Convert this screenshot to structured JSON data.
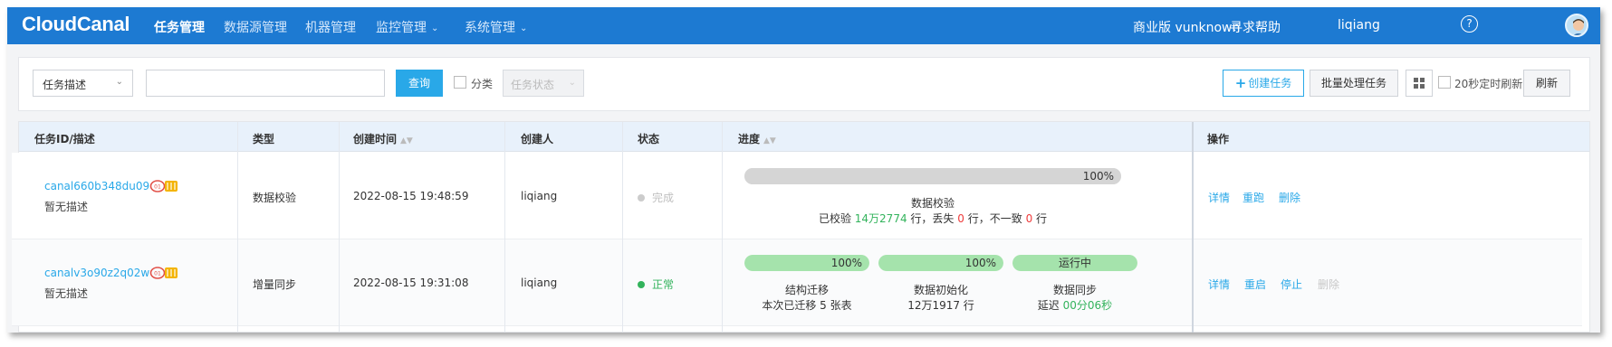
{
  "app": {
    "logo": "CloudCanal",
    "nav": [
      {
        "label": "任务管理",
        "active": true
      },
      {
        "label": "数据源管理"
      },
      {
        "label": "机器管理"
      },
      {
        "label": "监控管理",
        "dropdown": true
      },
      {
        "label": "系统管理",
        "dropdown": true
      }
    ],
    "license": "商业版 vunknown",
    "help": "寻求帮助",
    "help_icon": "?",
    "user": "liqiang"
  },
  "filters": {
    "search_field": "任务描述",
    "search_value": "",
    "query_button": "查询",
    "category_label": "分类",
    "status_placeholder": "任务状态",
    "create_button": "创建任务",
    "batch_button": "批量处理任务",
    "auto_refresh_label": "20秒定时刷新",
    "refresh_button": "刷新"
  },
  "table": {
    "columns": [
      "任务ID/描述",
      "类型",
      "创建时间",
      "创建人",
      "状态",
      "进度",
      "操作"
    ],
    "rows": [
      {
        "id": "canal660b348du09",
        "desc": "暂无描述",
        "type": "数据校验",
        "created": "2022-08-15 19:48:59",
        "creator": "liqiang",
        "status": "完成",
        "status_color": "#cccccc",
        "progress": {
          "bar_label": "100%",
          "fraction": 1.0,
          "stage": "数据校验",
          "detail_prefix": "已校验",
          "checked": "14万2774",
          "detail_mid1": "行，丢失",
          "lost": "0",
          "detail_mid2": "行，不一致",
          "inconsistent": "0",
          "detail_suffix": "行"
        },
        "actions": [
          "详情",
          "重跑",
          "删除"
        ]
      },
      {
        "id": "canalv3o90z2q02w",
        "desc": "暂无描述",
        "type": "增量同步",
        "created": "2022-08-15 19:31:08",
        "creator": "liqiang",
        "status": "正常",
        "status_color": "#33b35c",
        "progress": {
          "stages": [
            {
              "bar": "100%",
              "fraction": 1.0,
              "name": "结构迁移",
              "detail": "本次已迁移 5 张表"
            },
            {
              "bar": "100%",
              "fraction": 1.0,
              "name": "数据初始化",
              "detail": "12万1917 行"
            },
            {
              "bar": "运行中",
              "fraction": 1.0,
              "name": "数据同步",
              "detail_prefix": "延迟",
              "delay": "00分06秒"
            }
          ]
        },
        "actions": [
          "详情",
          "重启",
          "停止",
          "删除"
        ]
      }
    ]
  },
  "colors": {
    "nav_bg": "#1d7ad2",
    "accent": "#29a8e8",
    "bar_gray": "#d5d5d5",
    "bar_green": "#a5e3ac",
    "ok": "#33b35c",
    "error": "#ee3b3b"
  }
}
